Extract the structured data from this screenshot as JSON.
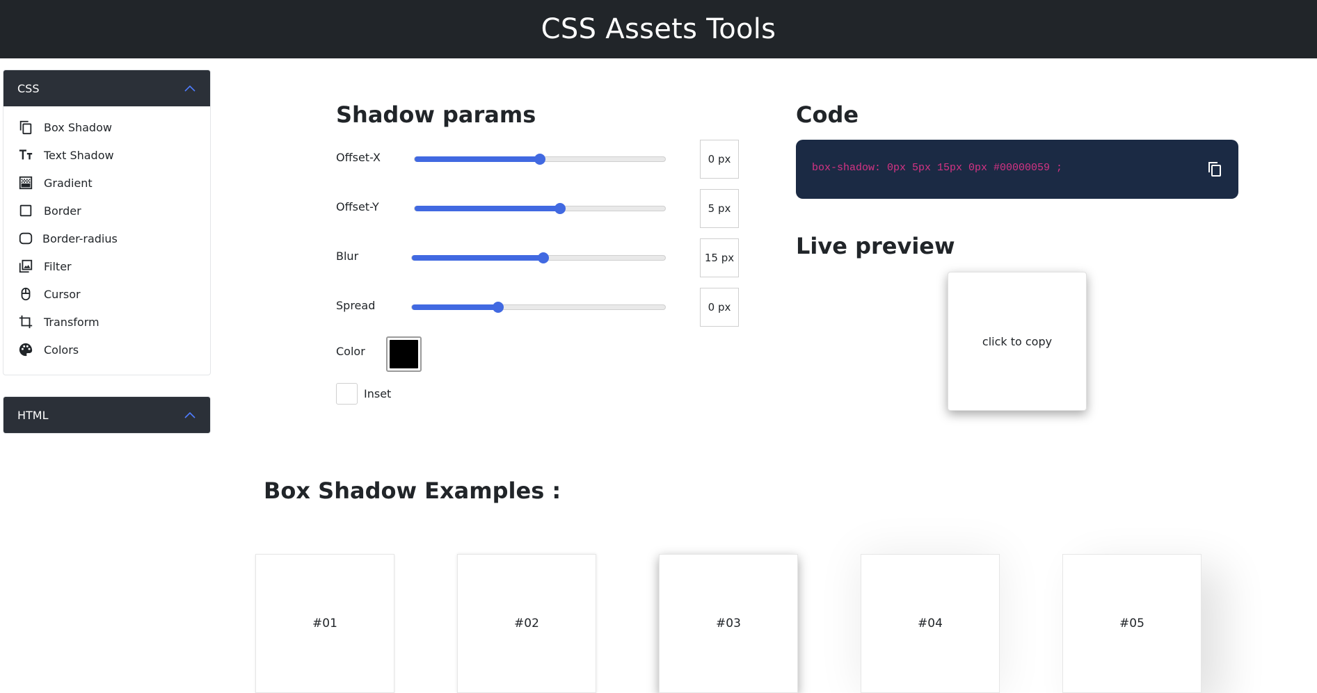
{
  "header": {
    "title": "CSS Assets Tools"
  },
  "sidebar": {
    "css_section": {
      "label": "CSS",
      "items": [
        {
          "label": "Box Shadow",
          "icon": "copy-icon"
        },
        {
          "label": "Text Shadow",
          "icon": "text-size-icon"
        },
        {
          "label": "Gradient",
          "icon": "gradient-icon"
        },
        {
          "label": "Border",
          "icon": "square-icon"
        },
        {
          "label": "Border-radius",
          "icon": "rounded-square-icon"
        },
        {
          "label": "Filter",
          "icon": "image-filter-icon"
        },
        {
          "label": "Cursor",
          "icon": "mouse-icon"
        },
        {
          "label": "Transform",
          "icon": "crop-icon"
        },
        {
          "label": "Colors",
          "icon": "palette-icon"
        }
      ]
    },
    "html_section": {
      "label": "HTML"
    }
  },
  "params": {
    "title": "Shadow params",
    "offset_x": {
      "label": "Offset-X",
      "value": "0 px",
      "level": 0.5
    },
    "offset_y": {
      "label": "Offset-Y",
      "value": "5 px",
      "level": 0.58
    },
    "blur": {
      "label": "Blur",
      "value": "15 px",
      "level": 0.52
    },
    "spread": {
      "label": "Spread",
      "value": "0 px",
      "level": 0.34
    },
    "color": {
      "label": "Color",
      "value": "#000000"
    },
    "inset": {
      "label": "Inset",
      "checked": false
    }
  },
  "code": {
    "title": "Code",
    "text": "box-shadow: 0px 5px 15px 0px #00000059 ;"
  },
  "preview": {
    "title": "Live preview",
    "box_text": "click to copy"
  },
  "examples": {
    "title": "Box Shadow Examples :",
    "items": [
      "#01",
      "#02",
      "#03",
      "#04",
      "#05"
    ]
  },
  "colors": {
    "header_bg": "#212529",
    "accent": "#4169e1",
    "code_bg": "#1b2a44",
    "code_text": "#d63384"
  }
}
